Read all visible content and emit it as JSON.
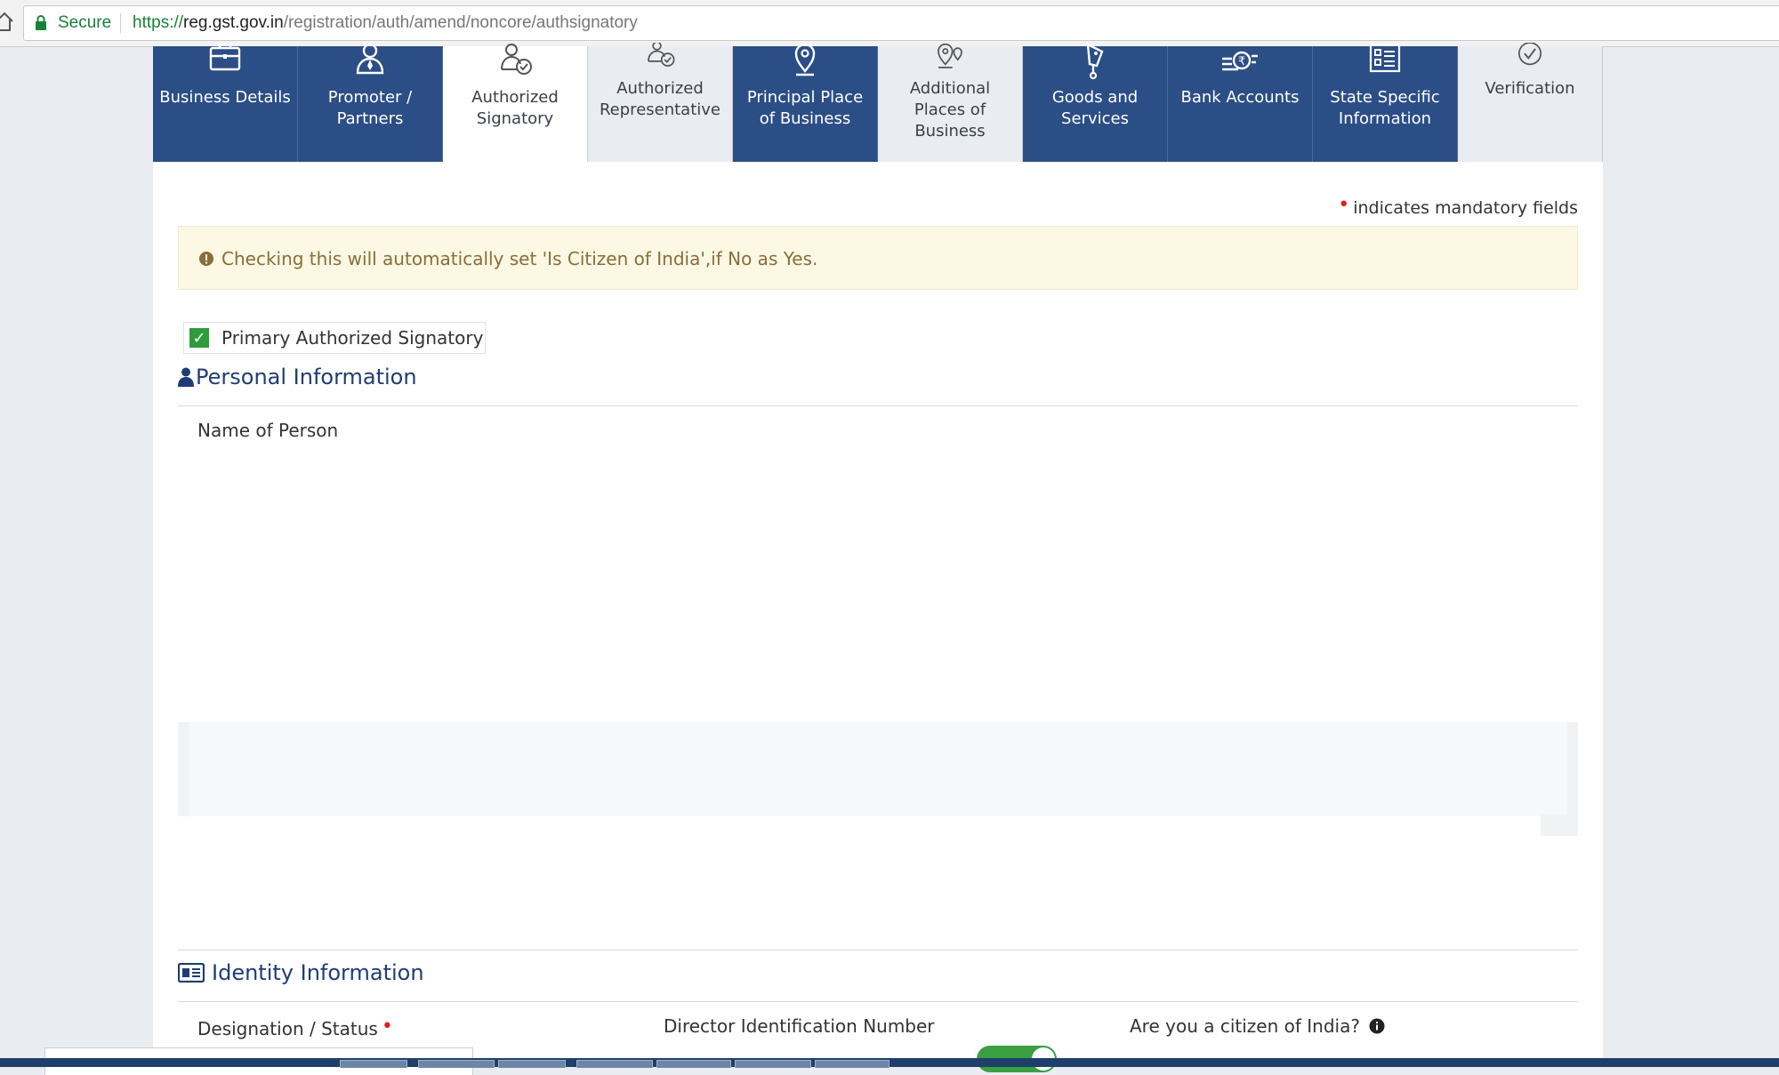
{
  "browser": {
    "secure_label": "Secure",
    "url_protocol": "https://",
    "url_host": "reg.gst.gov.in",
    "url_path": "/registration/auth/amend/noncore/authsignatory"
  },
  "tabs": [
    {
      "label": "Business Details",
      "icon": "briefcase-icon",
      "state": "complete"
    },
    {
      "label": "Promoter / Partners",
      "icon": "person-tie-icon",
      "state": "complete"
    },
    {
      "label": "Authorized Signatory",
      "icon": "person-check-icon",
      "state": "active"
    },
    {
      "label": "Authorized Representative",
      "icon": "person-check-icon",
      "state": "pending"
    },
    {
      "label": "Principal Place of Business",
      "icon": "map-pin-icon",
      "state": "complete"
    },
    {
      "label": "Additional Places of Business",
      "icon": "map-pins-icon",
      "state": "pending"
    },
    {
      "label": "Goods and Services",
      "icon": "tag-icon",
      "state": "complete"
    },
    {
      "label": "Bank Accounts",
      "icon": "rupee-coin-icon",
      "state": "complete"
    },
    {
      "label": "State Specific Information",
      "icon": "list-icon",
      "state": "complete"
    },
    {
      "label": "Verification",
      "icon": "check-circle-icon",
      "state": "pending"
    }
  ],
  "form": {
    "mandatory_note": "indicates mandatory fields",
    "info_banner": "Checking this will automatically set 'Is Citizen of India',if No as Yes.",
    "primary_checkbox_label": "Primary Authorized Signatory",
    "primary_checked": true,
    "personal_section_title": "Personal Information",
    "name_of_person_label": "Name of Person",
    "identity_section_title": "Identity Information",
    "designation_label": "Designation / Status",
    "din_label": "Director Identification Number",
    "citizen_label": "Are you a citizen of India?",
    "citizen_toggle_on": true
  },
  "colors": {
    "tab_blue": "#2c4e86",
    "heading_blue": "#1f3d74",
    "banner_bg": "#fcf8e3",
    "banner_text": "#8a6d3b",
    "mandatory_red": "#e0201c",
    "toggle_green": "#3aa041"
  }
}
